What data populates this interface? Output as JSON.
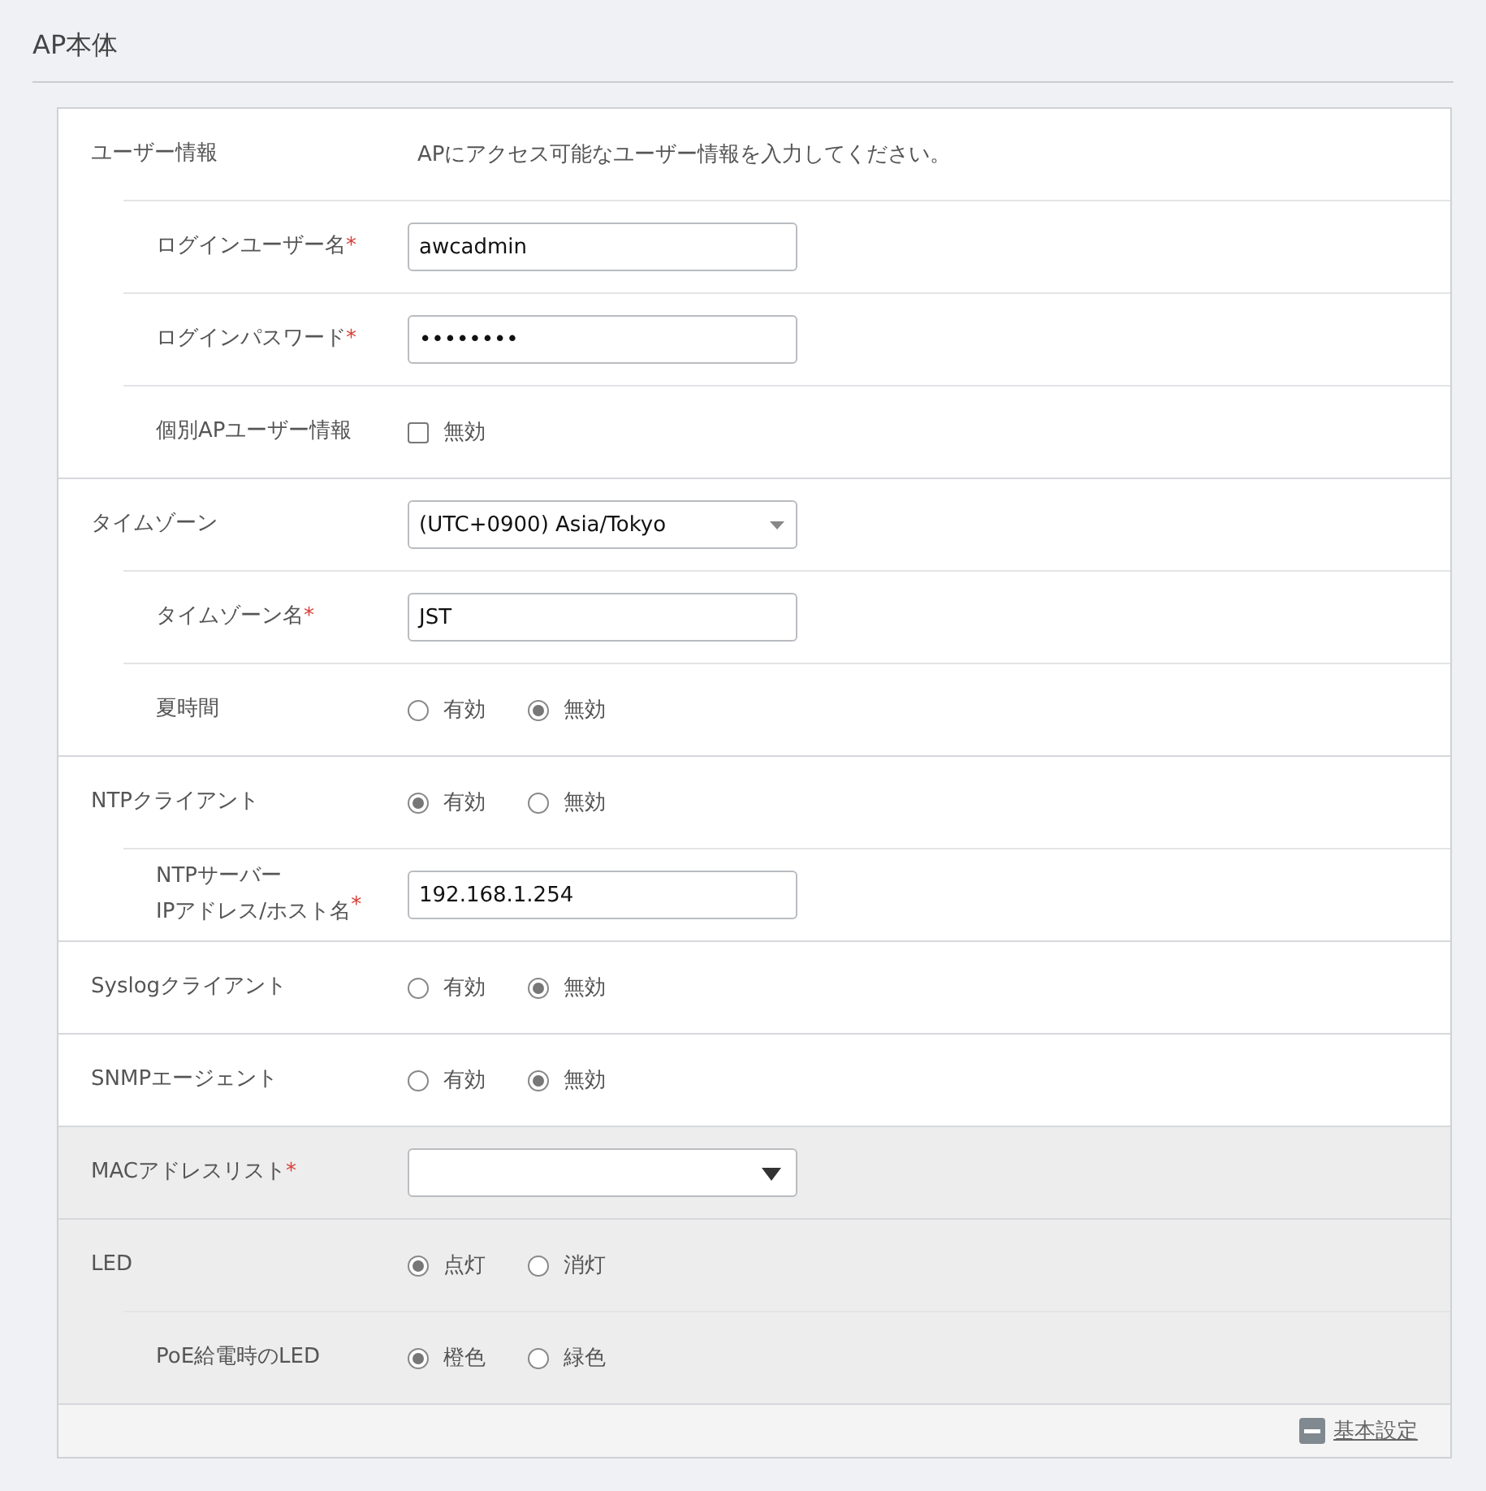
{
  "page": {
    "title": "AP本体"
  },
  "sections": [
    {
      "shaded": false,
      "rows": [
        {
          "label": "ユーザー情報",
          "kind": "description",
          "text": "APにアクセス可能なユーザー情報を入力してください。"
        },
        {
          "label": "ログインユーザー名",
          "required": "*",
          "kind": "text",
          "value": "awcadmin"
        },
        {
          "label": "ログインパスワード",
          "required": "*",
          "kind": "text",
          "value": "••••••••"
        },
        {
          "label": "個別APユーザー情報",
          "kind": "checkbox",
          "option": {
            "label": "無効",
            "checked": false
          }
        }
      ]
    },
    {
      "shaded": false,
      "rows": [
        {
          "label": "タイムゾーン",
          "kind": "select",
          "value": "(UTC+0900) Asia/Tokyo"
        },
        {
          "label": "タイムゾーン名",
          "required": "*",
          "kind": "text",
          "value": "JST"
        },
        {
          "label": "夏時間",
          "kind": "radio",
          "options": [
            {
              "label": "有効",
              "selected": false
            },
            {
              "label": "無効",
              "selected": true
            }
          ]
        }
      ]
    },
    {
      "shaded": false,
      "rows": [
        {
          "label": "NTPクライアント",
          "kind": "radio",
          "options": [
            {
              "label": "有効",
              "selected": true
            },
            {
              "label": "無効",
              "selected": false
            }
          ]
        },
        {
          "label": "NTPサーバー\nIPアドレス/ホスト名",
          "required": "*",
          "kind": "text",
          "value": "192.168.1.254"
        }
      ]
    },
    {
      "shaded": false,
      "rows": [
        {
          "label": "Syslogクライアント",
          "kind": "radio",
          "options": [
            {
              "label": "有効",
              "selected": false
            },
            {
              "label": "無効",
              "selected": true
            }
          ]
        }
      ]
    },
    {
      "shaded": false,
      "rows": [
        {
          "label": "SNMPエージェント",
          "kind": "radio",
          "options": [
            {
              "label": "有効",
              "selected": false
            },
            {
              "label": "無効",
              "selected": true
            }
          ]
        }
      ]
    },
    {
      "shaded": true,
      "rows": [
        {
          "label": "MACアドレスリスト",
          "required": "*",
          "kind": "list-select"
        }
      ]
    },
    {
      "shaded": true,
      "rows": [
        {
          "label": "LED",
          "kind": "radio",
          "options": [
            {
              "label": "点灯",
              "selected": true
            },
            {
              "label": "消灯",
              "selected": false
            }
          ]
        },
        {
          "label": "PoE給電時のLED",
          "kind": "radio",
          "options": [
            {
              "label": "橙色",
              "selected": true
            },
            {
              "label": "緑色",
              "selected": false
            }
          ]
        }
      ]
    }
  ],
  "footer": {
    "link": "基本設定"
  }
}
